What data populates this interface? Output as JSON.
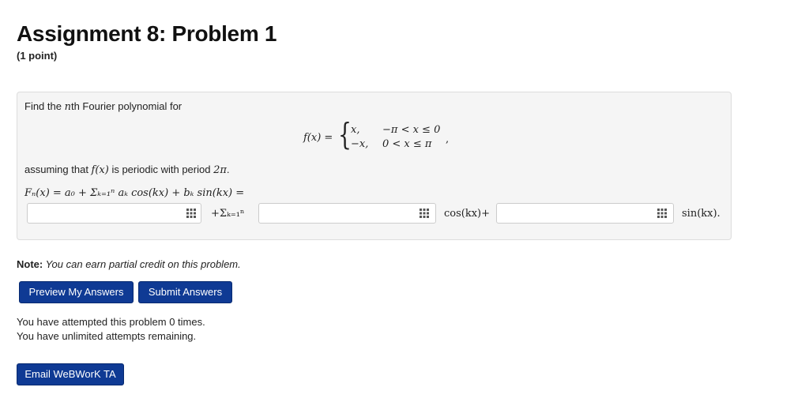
{
  "header": {
    "title": "Assignment 8: Problem 1",
    "points": "(1 point)"
  },
  "problem": {
    "prompt_pre": "Find the ",
    "prompt_n": "n",
    "prompt_post": "th Fourier polynomial for",
    "piecewise": {
      "lhs": "f(x) =",
      "row1_expr": "x,",
      "row1_cond": "−π < x ≤ 0",
      "row2_expr": "−x,",
      "row2_cond": "0 < x ≤ π",
      "trailing": ","
    },
    "assuming_pre": "assuming that ",
    "assuming_fx": "f(x)",
    "assuming_mid": " is periodic with period ",
    "assuming_period": "2π",
    "assuming_end": ".",
    "formula_line": "Fₙ(x) = a₀ + Σₖ₌₁ⁿ aₖ cos(kx) + bₖ sin(kx) =",
    "answer_1_value": "",
    "sum_label": "+Σₖ₌₁ⁿ",
    "answer_2_value": "",
    "cos_label": "cos(kx)+",
    "answer_3_value": "",
    "sin_label": "sin(kx)."
  },
  "note": {
    "label": "Note:",
    "text": " You can earn partial credit on this problem."
  },
  "buttons": {
    "preview": "Preview My Answers",
    "submit": "Submit Answers",
    "email": "Email WeBWorK TA"
  },
  "attempts": {
    "line1": "You have attempted this problem 0 times.",
    "line2": "You have unlimited attempts remaining."
  },
  "colors": {
    "button_bg": "#0f3a94",
    "problem_bg": "#f5f5f5"
  },
  "icons": {
    "equation_editor": "grid-icon"
  }
}
